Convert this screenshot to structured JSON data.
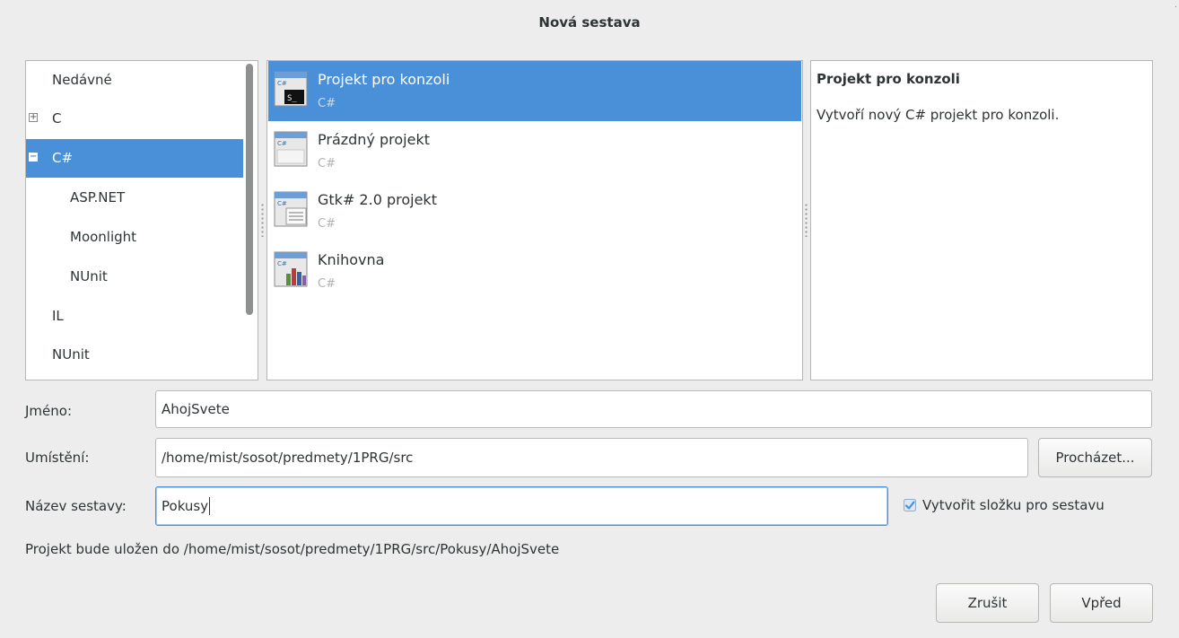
{
  "dialog": {
    "title": "Nová sestava"
  },
  "categories": [
    {
      "label": "Nedávné"
    },
    {
      "label": "C",
      "expander": "+"
    },
    {
      "label": "C#",
      "expander": "−"
    },
    {
      "label": "ASP.NET"
    },
    {
      "label": "Moonlight"
    },
    {
      "label": "NUnit"
    },
    {
      "label": "IL"
    },
    {
      "label": "NUnit"
    }
  ],
  "templates": [
    {
      "name": "Projekt pro konzoli",
      "lang": "C#",
      "icon": "console-project-icon",
      "selected": true
    },
    {
      "name": "Prázdný projekt",
      "lang": "C#",
      "icon": "empty-project-icon"
    },
    {
      "name": "Gtk# 2.0 projekt",
      "lang": "C#",
      "icon": "gtk-project-icon"
    },
    {
      "name": "Knihovna",
      "lang": "C#",
      "icon": "library-project-icon"
    }
  ],
  "description": {
    "title": "Projekt pro konzoli",
    "text": "Vytvoří nový C# projekt pro konzoli."
  },
  "form": {
    "name_label": "Jméno:",
    "name_value": "AhojSvete",
    "location_label": "Umístění:",
    "location_value": "/home/mist/sosot/predmety/1PRG/src",
    "browse_label": "Procházet...",
    "solution_label": "Název sestavy:",
    "solution_value": "Pokusy",
    "create_dir_label": "Vytvořit složku pro sestavu",
    "create_dir_checked": true
  },
  "info": "Projekt bude uložen do /home/mist/sosot/predmety/1PRG/src/Pokusy/AhojSvete",
  "buttons": {
    "cancel": "Zrušit",
    "forward": "Vpřed"
  },
  "colors": {
    "selection": "#4a90d9",
    "background": "#ededed",
    "focus_border": "#4a90d9"
  }
}
